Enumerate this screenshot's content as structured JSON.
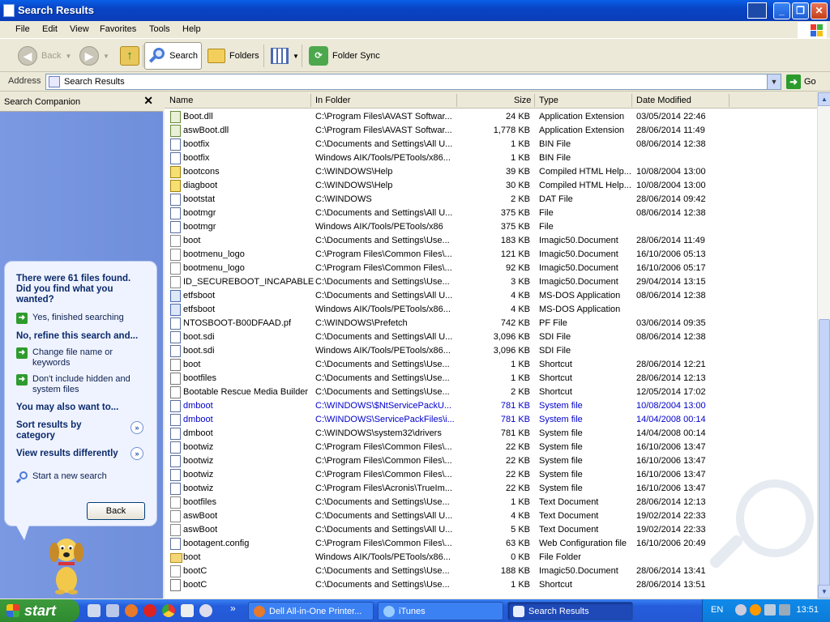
{
  "window": {
    "title": "Search Results"
  },
  "menu": [
    "File",
    "Edit",
    "View",
    "Favorites",
    "Tools",
    "Help"
  ],
  "toolbar": {
    "back": "Back",
    "search": "Search",
    "folders": "Folders",
    "folder_sync": "Folder Sync"
  },
  "address": {
    "label": "Address",
    "value": "Search Results",
    "go": "Go"
  },
  "left_pane": {
    "title": "Search Companion",
    "found": "There were 61 files found. Did you find what you wanted?",
    "yes": "Yes, finished searching",
    "refine": "No, refine this search and...",
    "change_name": "Change file name or keywords",
    "dont_include": "Don't include hidden and system files",
    "may_also": "You may also want to...",
    "sort": "Sort results by category",
    "view": "View results differently",
    "new_search": "Start a new search",
    "back_button": "Back"
  },
  "columns": {
    "name": "Name",
    "folder": "In Folder",
    "size": "Size",
    "type": "Type",
    "date": "Date Modified"
  },
  "rows": [
    {
      "name": "Boot.dll",
      "folder": "C:\\Program Files\\AVAST Softwar...",
      "size": "24 KB",
      "type": "Application Extension",
      "date": "03/05/2014 22:46",
      "icon": "dll"
    },
    {
      "name": "aswBoot.dll",
      "folder": "C:\\Program Files\\AVAST Softwar...",
      "size": "1,778 KB",
      "type": "Application Extension",
      "date": "28/06/2014 11:49",
      "icon": "dll"
    },
    {
      "name": "bootfix",
      "folder": "C:\\Documents and Settings\\All U...",
      "size": "1 KB",
      "type": "BIN File",
      "date": "08/06/2014 12:38",
      "icon": "file"
    },
    {
      "name": "bootfix",
      "folder": "Windows AIK/Tools/PETools/x86...",
      "size": "1 KB",
      "type": "BIN File",
      "date": "",
      "icon": "file"
    },
    {
      "name": "bootcons",
      "folder": "C:\\WINDOWS\\Help",
      "size": "39 KB",
      "type": "Compiled HTML Help...",
      "date": "10/08/2004 13:00",
      "icon": "help"
    },
    {
      "name": "diagboot",
      "folder": "C:\\WINDOWS\\Help",
      "size": "30 KB",
      "type": "Compiled HTML Help...",
      "date": "10/08/2004 13:00",
      "icon": "help"
    },
    {
      "name": "bootstat",
      "folder": "C:\\WINDOWS",
      "size": "2 KB",
      "type": "DAT File",
      "date": "28/06/2014 09:42",
      "icon": "file"
    },
    {
      "name": "bootmgr",
      "folder": "C:\\Documents and Settings\\All U...",
      "size": "375 KB",
      "type": "File",
      "date": "08/06/2014 12:38",
      "icon": "file"
    },
    {
      "name": "bootmgr",
      "folder": "Windows AIK/Tools/PETools/x86",
      "size": "375 KB",
      "type": "File",
      "date": "",
      "icon": "file"
    },
    {
      "name": "boot",
      "folder": "C:\\Documents and Settings\\Use...",
      "size": "183 KB",
      "type": "Imagic50.Document",
      "date": "28/06/2014 11:49",
      "icon": "txt"
    },
    {
      "name": "bootmenu_logo",
      "folder": "C:\\Program Files\\Common Files\\...",
      "size": "121 KB",
      "type": "Imagic50.Document",
      "date": "16/10/2006 05:13",
      "icon": "txt"
    },
    {
      "name": "bootmenu_logo",
      "folder": "C:\\Program Files\\Common Files\\...",
      "size": "92 KB",
      "type": "Imagic50.Document",
      "date": "16/10/2006 05:17",
      "icon": "txt"
    },
    {
      "name": "ID_SECUREBOOT_INCAPABLE",
      "folder": "C:\\Documents and Settings\\Use...",
      "size": "3 KB",
      "type": "Imagic50.Document",
      "date": "29/04/2014 13:15",
      "icon": "txt"
    },
    {
      "name": "etfsboot",
      "folder": "C:\\Documents and Settings\\All U...",
      "size": "4 KB",
      "type": "MS-DOS Application",
      "date": "08/06/2014 12:38",
      "icon": "exe"
    },
    {
      "name": "etfsboot",
      "folder": "Windows AIK/Tools/PETools/x86...",
      "size": "4 KB",
      "type": "MS-DOS Application",
      "date": "",
      "icon": "exe"
    },
    {
      "name": "NTOSBOOT-B00DFAAD.pf",
      "folder": "C:\\WINDOWS\\Prefetch",
      "size": "742 KB",
      "type": "PF File",
      "date": "03/06/2014 09:35",
      "icon": "file"
    },
    {
      "name": "boot.sdi",
      "folder": "C:\\Documents and Settings\\All U...",
      "size": "3,096 KB",
      "type": "SDI File",
      "date": "08/06/2014 12:38",
      "icon": "file"
    },
    {
      "name": "boot.sdi",
      "folder": "Windows AIK/Tools/PETools/x86...",
      "size": "3,096 KB",
      "type": "SDI File",
      "date": "",
      "icon": "file"
    },
    {
      "name": "boot",
      "folder": "C:\\Documents and Settings\\Use...",
      "size": "1 KB",
      "type": "Shortcut",
      "date": "28/06/2014 12:21",
      "icon": "shortcut"
    },
    {
      "name": "bootfiles",
      "folder": "C:\\Documents and Settings\\Use...",
      "size": "1 KB",
      "type": "Shortcut",
      "date": "28/06/2014 12:13",
      "icon": "shortcut"
    },
    {
      "name": "Bootable Rescue Media Builder",
      "folder": "C:\\Documents and Settings\\Use...",
      "size": "2 KB",
      "type": "Shortcut",
      "date": "12/05/2014 17:02",
      "icon": "shortcut"
    },
    {
      "name": "dmboot",
      "folder": "C:\\WINDOWS\\$NtServicePackU...",
      "size": "781 KB",
      "type": "System file",
      "date": "10/08/2004 13:00",
      "icon": "file",
      "blue": true
    },
    {
      "name": "dmboot",
      "folder": "C:\\WINDOWS\\ServicePackFiles\\i...",
      "size": "781 KB",
      "type": "System file",
      "date": "14/04/2008 00:14",
      "icon": "file",
      "blue": true
    },
    {
      "name": "dmboot",
      "folder": "C:\\WINDOWS\\system32\\drivers",
      "size": "781 KB",
      "type": "System file",
      "date": "14/04/2008 00:14",
      "icon": "file"
    },
    {
      "name": "bootwiz",
      "folder": "C:\\Program Files\\Common Files\\...",
      "size": "22 KB",
      "type": "System file",
      "date": "16/10/2006 13:47",
      "icon": "file"
    },
    {
      "name": "bootwiz",
      "folder": "C:\\Program Files\\Common Files\\...",
      "size": "22 KB",
      "type": "System file",
      "date": "16/10/2006 13:47",
      "icon": "file"
    },
    {
      "name": "bootwiz",
      "folder": "C:\\Program Files\\Common Files\\...",
      "size": "22 KB",
      "type": "System file",
      "date": "16/10/2006 13:47",
      "icon": "file"
    },
    {
      "name": "bootwiz",
      "folder": "C:\\Program Files\\Acronis\\TrueIm...",
      "size": "22 KB",
      "type": "System file",
      "date": "16/10/2006 13:47",
      "icon": "file"
    },
    {
      "name": "bootfiles",
      "folder": "C:\\Documents and Settings\\Use...",
      "size": "1 KB",
      "type": "Text Document",
      "date": "28/06/2014 12:13",
      "icon": "txt"
    },
    {
      "name": "aswBoot",
      "folder": "C:\\Documents and Settings\\All U...",
      "size": "4 KB",
      "type": "Text Document",
      "date": "19/02/2014 22:33",
      "icon": "txt"
    },
    {
      "name": "aswBoot",
      "folder": "C:\\Documents and Settings\\All U...",
      "size": "5 KB",
      "type": "Text Document",
      "date": "19/02/2014 22:33",
      "icon": "txt"
    },
    {
      "name": "bootagent.config",
      "folder": "C:\\Program Files\\Common Files\\...",
      "size": "63 KB",
      "type": "Web Configuration file",
      "date": "16/10/2006 20:49",
      "icon": "file"
    },
    {
      "name": "boot",
      "folder": "Windows AIK/Tools/PETools/x86...",
      "size": "0 KB",
      "type": "File Folder",
      "date": "",
      "icon": "folder"
    },
    {
      "name": "bootC",
      "folder": "C:\\Documents and Settings\\Use...",
      "size": "188 KB",
      "type": "Imagic50.Document",
      "date": "28/06/2014 13:41",
      "icon": "txt"
    },
    {
      "name": "bootC",
      "folder": "C:\\Documents and Settings\\Use...",
      "size": "1 KB",
      "type": "Shortcut",
      "date": "28/06/2014 13:51",
      "icon": "shortcut"
    }
  ],
  "taskbar": {
    "start": "start",
    "tasks": [
      "Dell All-in-One Printer...",
      "iTunes",
      "Search Results"
    ],
    "lang": "EN",
    "clock": "13:51"
  }
}
